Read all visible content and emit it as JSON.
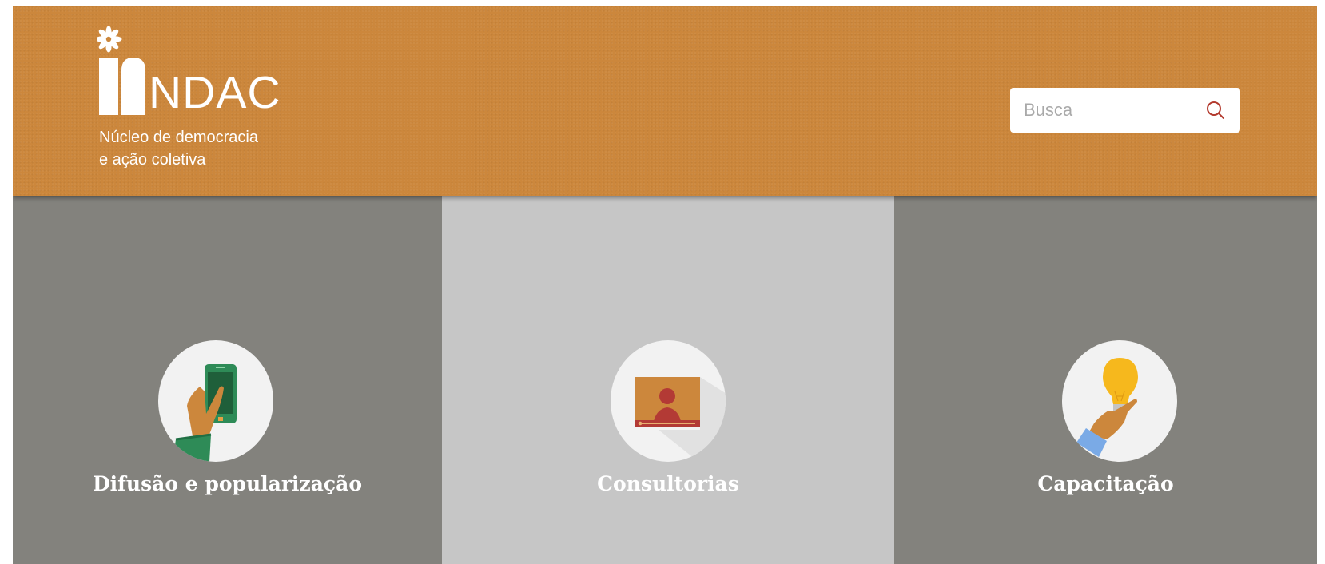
{
  "header": {
    "logo": {
      "name": "NDAC",
      "subtitle_line1": "Núcleo de democracia",
      "subtitle_line2": "e ação coletiva"
    },
    "search": {
      "placeholder": "Busca",
      "value": "",
      "icon": "search-icon"
    }
  },
  "colors": {
    "header_bg": "#cc873c",
    "panel_dark": "#83827d",
    "panel_light": "#c6c6c6",
    "search_icon": "#b33a2e"
  },
  "panels": [
    {
      "label": "Difusão e popularização",
      "icon": "hand-phone-icon",
      "bg": "#83827d"
    },
    {
      "label": "Consultorias",
      "icon": "video-person-icon",
      "bg": "#c6c6c6"
    },
    {
      "label": "Capacitação",
      "icon": "hand-lightbulb-icon",
      "bg": "#83827d"
    }
  ]
}
